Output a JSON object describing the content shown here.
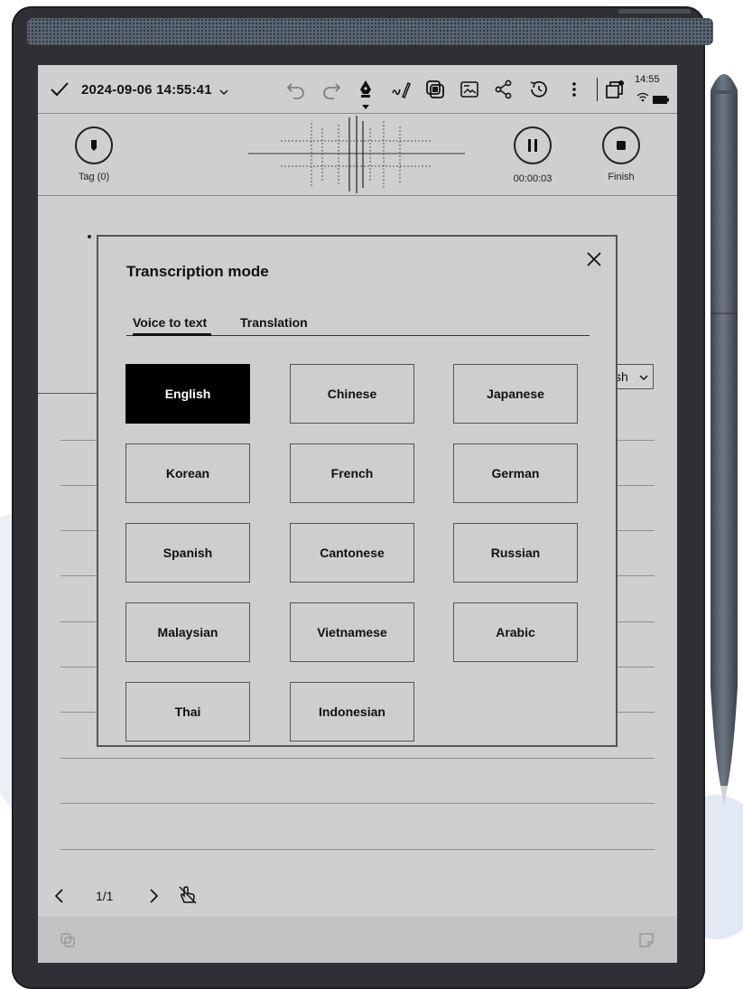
{
  "toolbar": {
    "date_time": "2024-09-06 14:55:41",
    "clock": "14:55"
  },
  "recording": {
    "tag_label": "Tag (0)",
    "elapsed": "00:00:03",
    "finish_label": "Finish"
  },
  "page_behind": {
    "language_dropdown": "sh"
  },
  "dialog": {
    "title": "Transcription mode",
    "tabs": [
      {
        "label": "Voice to text",
        "active": true
      },
      {
        "label": "Translation",
        "active": false
      }
    ],
    "languages": [
      {
        "label": "English",
        "selected": true
      },
      {
        "label": "Chinese",
        "selected": false
      },
      {
        "label": "Japanese",
        "selected": false
      },
      {
        "label": "Korean",
        "selected": false
      },
      {
        "label": "French",
        "selected": false
      },
      {
        "label": "German",
        "selected": false
      },
      {
        "label": "Spanish",
        "selected": false
      },
      {
        "label": "Cantonese",
        "selected": false
      },
      {
        "label": "Russian",
        "selected": false
      },
      {
        "label": "Malaysian",
        "selected": false
      },
      {
        "label": "Vietnamese",
        "selected": false
      },
      {
        "label": "Arabic",
        "selected": false
      },
      {
        "label": "Thai",
        "selected": false
      },
      {
        "label": "Indonesian",
        "selected": false
      }
    ]
  },
  "pager": {
    "page_indicator": "1/1"
  },
  "icons": [
    "check-icon",
    "chevron-down-icon",
    "undo-icon",
    "redo-icon",
    "pen-icon",
    "handwriting-icon",
    "layers-icon",
    "image-icon",
    "share-icon",
    "history-icon",
    "more-icon",
    "window-icon",
    "wifi-icon",
    "battery-icon",
    "tag-icon",
    "pause-icon",
    "stop-icon",
    "close-icon",
    "prev-page-icon",
    "next-page-icon",
    "touch-lock-icon"
  ]
}
